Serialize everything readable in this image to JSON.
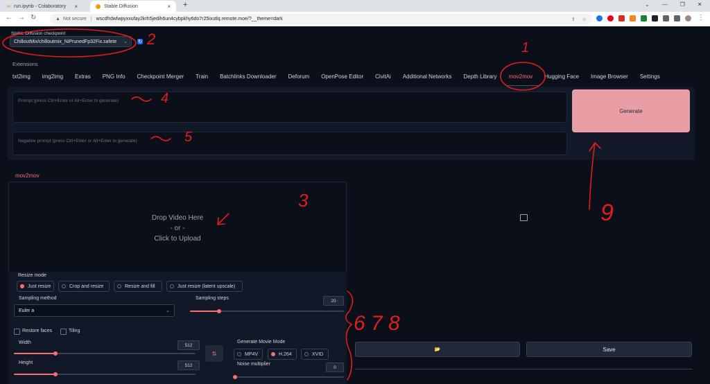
{
  "browser": {
    "tabs": [
      {
        "title": "run.ipynb - Colaboratory",
        "close": "×"
      },
      {
        "title": "Stable Diffusion",
        "close": "×"
      }
    ],
    "new_tab": "+",
    "not_secure": "Not secure",
    "url": "wscdfrdwlwpyxxufay2krh5jedih6un4cybpkhy6do7r25ixutlq.remote.moe/?__theme=dark",
    "window_controls": [
      "⌄",
      "—",
      "❐",
      "✕"
    ]
  },
  "checkpoint": {
    "label": "Stable Diffusion checkpoint",
    "value": "ChilloutMix/chilloutmix_NiPrunedFp32Fix.safete"
  },
  "extensions_label": "Extensions",
  "tabs": [
    "txt2img",
    "img2img",
    "Extras",
    "PNG Info",
    "Checkpoint Merger",
    "Train",
    "Batchlinks Downloader",
    "Deforum",
    "OpenPose Editor",
    "CivitAi",
    "Additional Networks",
    "Depth Library",
    "mov2mov",
    "Hugging Face",
    "Image Browser",
    "Settings"
  ],
  "prompt_placeholder": "Prompt (press Ctrl+Enter or Alt+Enter to generate)",
  "negative_placeholder": "Negative prompt (press Ctrl+Enter or Alt+Enter to generate)",
  "generate_label": "Generate",
  "section_title": "mov2mov",
  "drop": {
    "line1": "Drop Video Here",
    "line2": "- or -",
    "line3": "Click to Upload"
  },
  "resize": {
    "label": "Resize mode",
    "options": [
      "Just resize",
      "Crop and resize",
      "Resize and fill",
      "Just resize (latent upscale)"
    ],
    "selected": "Just resize"
  },
  "sampling_method": {
    "label": "Sampling method",
    "value": "Euler a"
  },
  "sampling_steps": {
    "label": "Sampling steps",
    "value": "20",
    "fraction": 0.19
  },
  "restore_faces": "Restore faces",
  "tiling": "Tiling",
  "width": {
    "label": "Width",
    "value": "512",
    "fraction": 0.23
  },
  "height": {
    "label": "Height",
    "value": "512",
    "fraction": 0.23
  },
  "swap_icon": "⇅",
  "movie_mode": {
    "label": "Generate Movie Mode",
    "options": [
      "MP4V",
      "H.264",
      "XVID"
    ],
    "selected": "H.264"
  },
  "noise_multiplier": {
    "label": "Noise multiplier",
    "value": "0",
    "fraction": 0.0
  },
  "folder_icon": "📂",
  "save_label": "Save",
  "annotations": [
    "1",
    "2",
    "3",
    "4",
    "5",
    "6 7 8",
    "9"
  ],
  "colors": {
    "accent": "#f87171",
    "generate": "#e99ea6",
    "background": "#0b0f19",
    "panel": "#111827",
    "annotation_ink": "#e11d1d"
  }
}
